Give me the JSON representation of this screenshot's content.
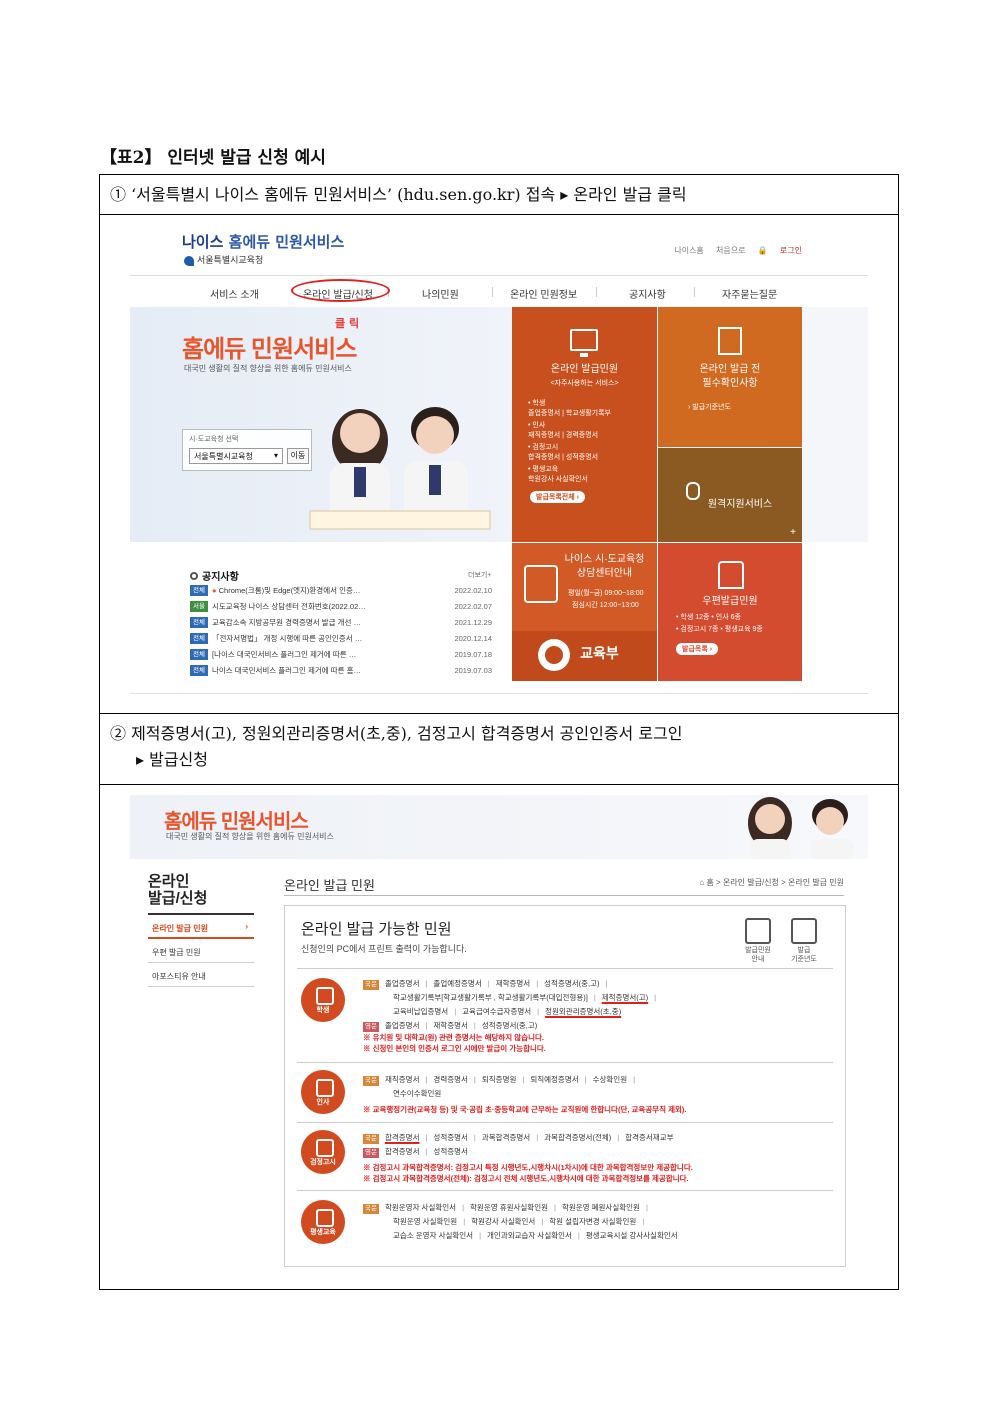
{
  "doc_title": "【표2】 인터넷 발급 신청 예시",
  "step1": "① ‘서울특별시 나이스 홈에듀 민원서비스’ (hdu.sen.go.kr) 접속 ▸ 온라인 발급 클릭",
  "step2_line1": "② 제적증명서(고), 정원외관리증명서(초,중), 검정고시 합격증명서 공인인증서 로그인",
  "step2_line2": "▸ 발급신청",
  "shot1": {
    "logo_ni": "나이스",
    "logo_rest": "홈에듀 민원서비스",
    "logo_sub": "서울특별시교육청",
    "top_links": [
      "나이스홈",
      "처음으로",
      "로그인"
    ],
    "nav": [
      "서비스 소개",
      "온라인 발급/신청",
      "나의민원",
      "온라인 민원정보",
      "공지사항",
      "자주묻는질문"
    ],
    "click_label": "클 릭",
    "hero_title": "홈에듀 민원서비스",
    "hero_sub": "대국민 생활의 질적 향상을 위한 홈에듀 민원서비스",
    "region_label": "시·도교육청 선택",
    "region_value": "서울특별시교육청",
    "region_go": "이동",
    "tile1": {
      "title": "온라인 발급민원",
      "sub": "<자주사용하는 서비스>",
      "items": [
        "• 학생",
        "  졸업증명서 | 학교생활기록부",
        "• 인사",
        "  재직증명서 | 경력증명서",
        "• 검정고시",
        "  합격증명서 | 성적증명서",
        "• 평생교육",
        "  학원강사 사실확인서"
      ],
      "button": "발급목록전체"
    },
    "tile2": {
      "title": "온라인 발급 전",
      "title2": "필수확인사항",
      "link": "발급기준년도"
    },
    "tile3": {
      "title": "원격지원서비스"
    },
    "tile4": {
      "title": "나이스 시·도교육청",
      "title2": "상담센터안내",
      "hours1": "평일(월~금) 09:00~18:00",
      "hours2": "점심시간 12:00~13:00"
    },
    "tile4b": {
      "title": "교육부"
    },
    "tile5": {
      "title": "우편발급민원",
      "items": [
        "• 학생 12종   • 인사 6종",
        "• 검정고시 7종 • 평생교육 9종"
      ],
      "button": "발급목록"
    },
    "notice_title": "공지사항",
    "notice_more": "더보기+",
    "notices": [
      {
        "badge": "전체",
        "title": "Chrome(크롬)및 Edge(엣지)환경에서 인증…",
        "date": "2022.02.10"
      },
      {
        "badge": "서울",
        "title": "시도교육청 나이스 상담센터 전화번호(2022.02…",
        "date": "2022.02.07"
      },
      {
        "badge": "전체",
        "title": "교육감소속 지방공무원 경력증명서 발급 개선 …",
        "date": "2021.12.29"
      },
      {
        "badge": "전체",
        "title": "「전자서명법」 개정 시행에 따른 공인인증서 …",
        "date": "2020.12.14"
      },
      {
        "badge": "전체",
        "title": "[나이스 대국민서비스 플러그인 제거에 따른 …",
        "date": "2019.07.18"
      },
      {
        "badge": "전체",
        "title": "나이스 대국민서비스 플러그인 제거에 따른 홈…",
        "date": "2019.07.03"
      }
    ]
  },
  "shot2": {
    "banner_title": "홈에듀 민원서비스",
    "banner_sub": "대국민 생활의 질적 향상을 위한 홈에듀 민원서비스",
    "side_title1": "온라인",
    "side_title2": "발급/신청",
    "side_items": [
      "온라인 발급 민원",
      "우편 발급 민원",
      "아포스티유 안내"
    ],
    "page_title": "온라인 발급 민원",
    "breadcrumb": "⌂ 홈 > 온라인 발급/신청 > 온라인 발급 민원",
    "panel_title": "온라인 발급 가능한 민원",
    "panel_sub": "신청인의 PC에서 프린트 출력이 가능합니다.",
    "icon1_label1": "발급민원",
    "icon1_label2": "안내",
    "icon2_label1": "발급",
    "icon2_label2": "기준년도",
    "cat_student": "학생",
    "cat_hr": "인사",
    "cat_exam": "검정고시",
    "cat_life": "평생교육",
    "tag_kr": "국문",
    "tag_en": "영문",
    "student": {
      "l1": [
        "졸업증명서",
        "졸업예정증명서",
        "재학증명서",
        "성적증명서(중,고)"
      ],
      "l2a": "학교생활기록부[학교생활기록부 , 학교생활기록부(대입전형용)]",
      "l2b": "제적증명서(고)",
      "l3a": [
        "교육비납입증명서",
        "교육급여수급자증명서"
      ],
      "l3b": "정원외관리증명서(초,중)",
      "l4": [
        "졸업증명서",
        "재학증명서",
        "성적증명서(중,고)"
      ],
      "n1": "※ 유치원 및 대학교(원) 관련 증명서는 해당하지 않습니다.",
      "n2": "※ 신청인 본인의 인증서 로그인 시에만 발급이 가능합니다."
    },
    "hr": {
      "l1": [
        "재직증명서",
        "경력증명서",
        "퇴직증명원",
        "퇴직예정증명서",
        "수상확인원"
      ],
      "l2": "연수이수확인원",
      "n1": "※ 교육행정기관(교육청 등) 및 국·공립 초·중등학교에 근무하는 교직원에 한합니다(단, 교육공무직 제외)."
    },
    "exam": {
      "l1a": "합격증명서",
      "l1b": [
        "성적증명서",
        "과목합격증명서",
        "과목합격증명서(전체)",
        "합격증서재교부"
      ],
      "l2": [
        "합격증명서",
        "성적증명서"
      ],
      "n1": "※ 검정고시 과목합격증명서: 검정고시 특정 시행년도,시행차시(1차시)에 대한 과목합격정보만 제공합니다.",
      "n2": "※ 검정고시 과목합격증명서(전체): 검정고시 전체 시행년도,시행차시에 대한 과목합격정보를 제공합니다."
    },
    "life": {
      "l1": [
        "학원운영자 사실확인서",
        "학원운영 휴원사실확인원",
        "학원운영 폐원사실확인원"
      ],
      "l2": [
        "학원운영 사실확인원",
        "학원강사 사실확인서",
        "학원 설립자변경 사실확인원"
      ],
      "l3": [
        "교습소 운영자 사실확인서",
        "개인과외교습자 사실확인서",
        "평생교육시설 강사사실확인서"
      ]
    }
  }
}
